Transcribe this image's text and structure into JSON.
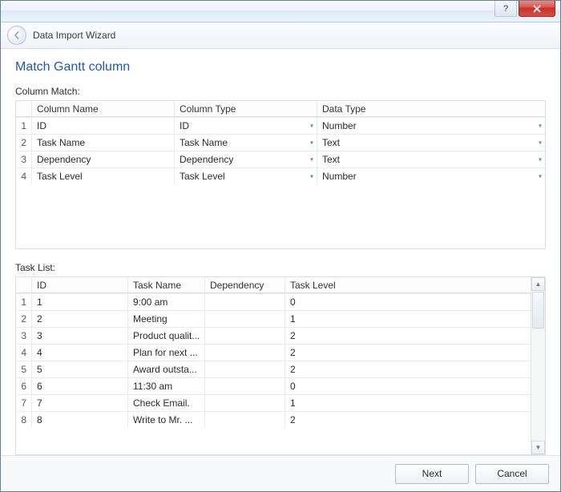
{
  "window": {
    "title": "Data Import Wizard"
  },
  "page": {
    "heading": "Match Gantt column",
    "column_match_label": "Column Match:",
    "task_list_label": "Task List:"
  },
  "column_match": {
    "headers": {
      "index": "",
      "column_name": "Column Name",
      "column_type": "Column Type",
      "data_type": "Data Type"
    },
    "rows": [
      {
        "n": "1",
        "name": "ID",
        "type": "ID",
        "data": "Number"
      },
      {
        "n": "2",
        "name": "Task Name",
        "type": "Task Name",
        "data": "Text"
      },
      {
        "n": "3",
        "name": "Dependency",
        "type": "Dependency",
        "data": "Text"
      },
      {
        "n": "4",
        "name": "Task Level",
        "type": "Task Level",
        "data": "Number"
      }
    ]
  },
  "task_list": {
    "headers": {
      "index": "",
      "id": "ID",
      "task_name": "Task Name",
      "dependency": "Dependency",
      "task_level": "Task Level"
    },
    "rows": [
      {
        "n": "1",
        "id": "1",
        "name": "9:00 am",
        "dep": "",
        "level": "0"
      },
      {
        "n": "2",
        "id": "2",
        "name": "Meeting",
        "dep": "",
        "level": "1"
      },
      {
        "n": "3",
        "id": "3",
        "name": "Product qualit...",
        "dep": "",
        "level": "2"
      },
      {
        "n": "4",
        "id": "4",
        "name": "Plan for next ...",
        "dep": "",
        "level": "2"
      },
      {
        "n": "5",
        "id": "5",
        "name": "Award outsta...",
        "dep": "",
        "level": "2"
      },
      {
        "n": "6",
        "id": "6",
        "name": "11:30 am",
        "dep": "",
        "level": "0"
      },
      {
        "n": "7",
        "id": "7",
        "name": "Check Email.",
        "dep": "",
        "level": "1"
      },
      {
        "n": "8",
        "id": "8",
        "name": "Write to Mr. ...",
        "dep": "",
        "level": "2"
      }
    ]
  },
  "footer": {
    "next": "Next",
    "cancel": "Cancel"
  }
}
